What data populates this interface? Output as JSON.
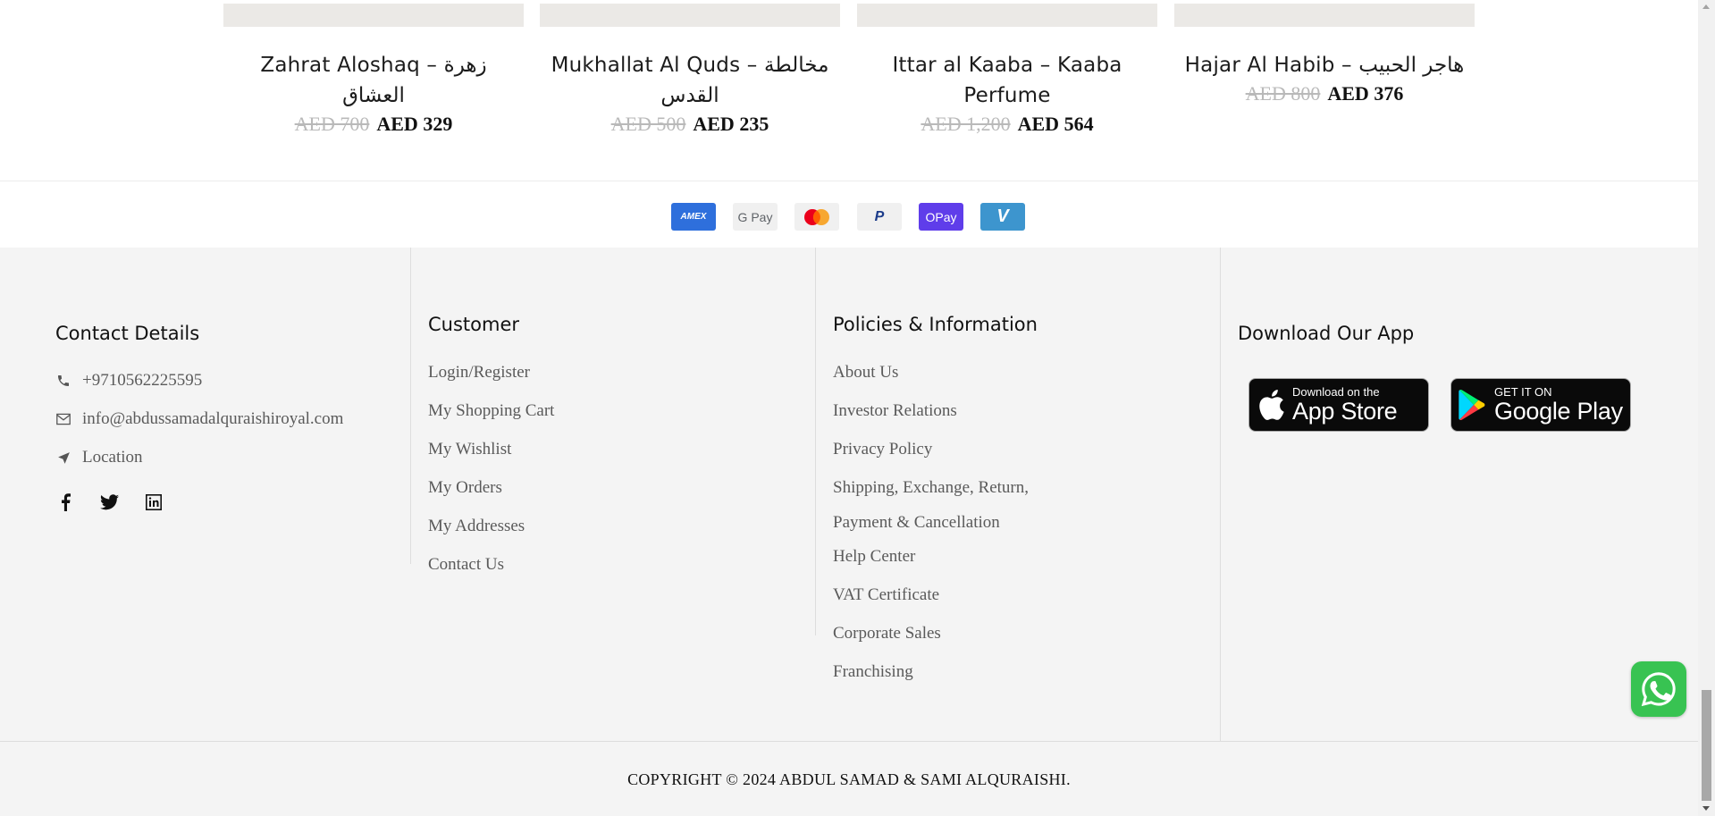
{
  "products": [
    {
      "name": "Zahrat Aloshaq – زهرة العشاق",
      "old_price": "AED 700",
      "new_price": "AED 329"
    },
    {
      "name": "Mukhallat Al Quds – مخالطة القدس",
      "old_price": "AED 500",
      "new_price": "AED 235"
    },
    {
      "name": "Ittar al Kaaba – Kaaba Perfume",
      "old_price": "AED 1,200",
      "new_price": "AED 564"
    },
    {
      "name": "Hajar Al Habib – هاجر الحبيب",
      "old_price": "AED 800",
      "new_price": "AED 376"
    }
  ],
  "payments": {
    "amex": "AMEX",
    "gpay": "G Pay",
    "paypal": "P",
    "opay": "OPay",
    "venmo": "V"
  },
  "contact": {
    "title": "Contact Details",
    "phone": "+9710562225595",
    "email": "info@abdussamadalquraishiroyal.com",
    "location": "Location"
  },
  "customer": {
    "title": "Customer",
    "links": [
      "Login/Register",
      "My Shopping Cart",
      "My Wishlist",
      "My Orders",
      "My Addresses",
      "Contact Us"
    ]
  },
  "policies": {
    "title": "Policies & Information",
    "links": [
      "About Us",
      "Investor Relations",
      "Privacy Policy",
      "Shipping, Exchange, Return,",
      "Payment & Cancellation",
      "Help Center",
      "VAT Certificate",
      "Corporate Sales",
      "Franchising"
    ]
  },
  "app": {
    "title": "Download Our App",
    "appstore_small": "Download on the",
    "appstore_big": "App Store",
    "googleplay_small": "GET IT ON",
    "googleplay_big": "Google Play"
  },
  "copyright": "COPYRIGHT © 2024 ABDUL SAMAD & SAMI ALQURAISHI.",
  "colors": {
    "footer_bg": "#f4f4f4",
    "whatsapp": "#38c352",
    "old_price": "#b9b9b9"
  }
}
